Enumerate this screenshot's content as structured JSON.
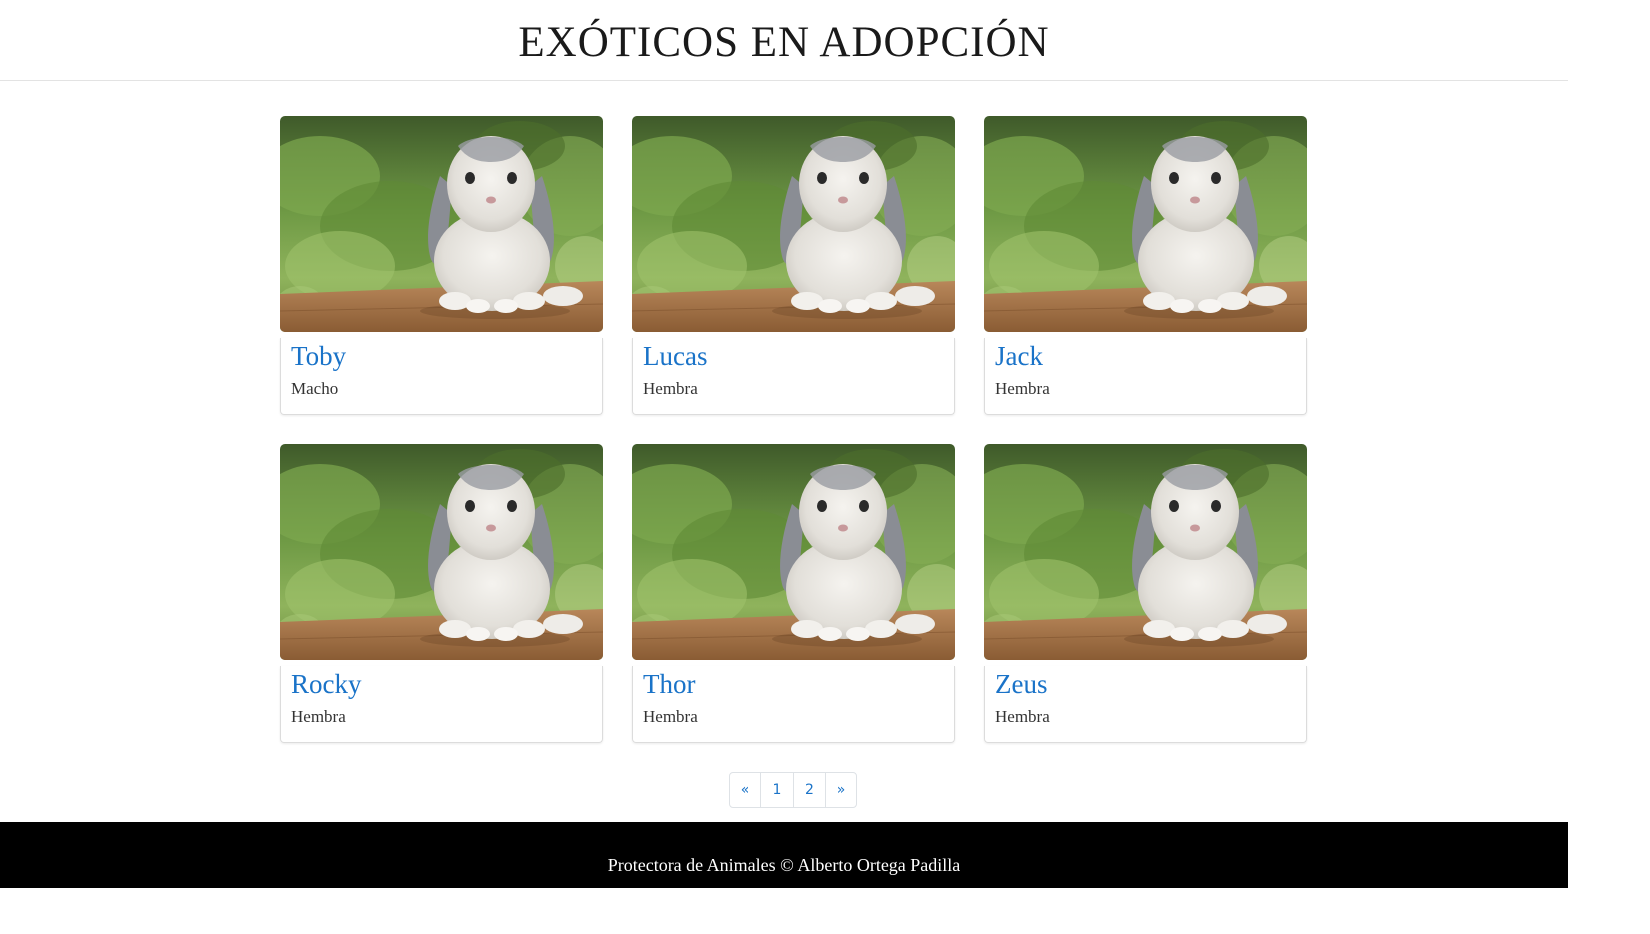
{
  "header": {
    "title": "EXÓTICOS EN ADOPCIÓN"
  },
  "pets": [
    {
      "name": "Toby",
      "sex": "Macho"
    },
    {
      "name": "Lucas",
      "sex": "Hembra"
    },
    {
      "name": "Jack",
      "sex": "Hembra"
    },
    {
      "name": "Rocky",
      "sex": "Hembra"
    },
    {
      "name": "Thor",
      "sex": "Hembra"
    },
    {
      "name": "Zeus",
      "sex": "Hembra"
    }
  ],
  "pagination": {
    "prev": "«",
    "pages": [
      "1",
      "2"
    ],
    "next": "»"
  },
  "footer": {
    "text": "Protectora de Animales © Alberto Ortega Padilla"
  },
  "colors": {
    "link": "#1a73c8",
    "footer_bg": "#000000",
    "footer_text": "#ffffff"
  },
  "image_subject": "rabbit-photo"
}
